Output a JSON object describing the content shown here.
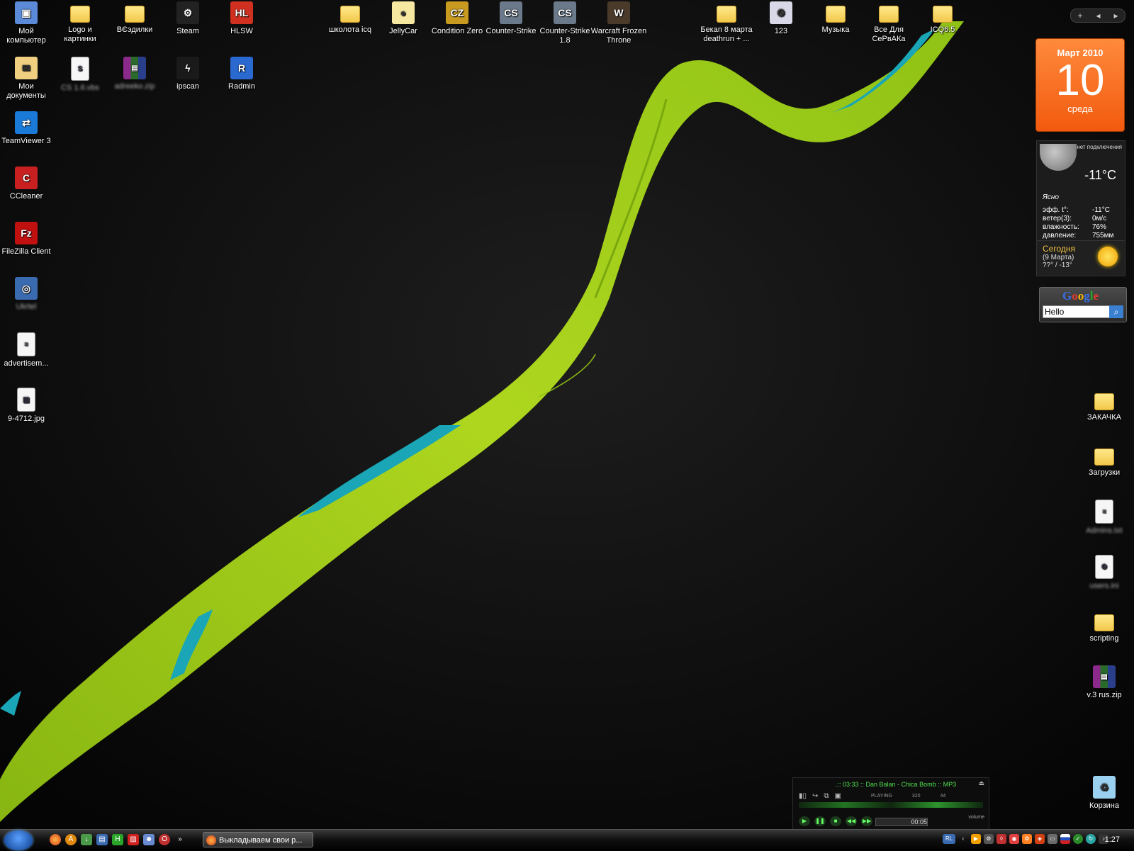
{
  "desktop": {
    "top_icons": [
      {
        "label": "Мой компьютер",
        "icon": "computer-icon"
      },
      {
        "label": "Logo и картинки",
        "icon": "folder-icon"
      },
      {
        "label": "ВЄэдилки",
        "icon": "folder-icon"
      },
      {
        "label": "Steam",
        "icon": "steam-icon"
      },
      {
        "label": "HLSW",
        "icon": "hlsw-icon"
      },
      {
        "label": "школота icq",
        "icon": "folder-icon"
      },
      {
        "label": "JellyCar",
        "icon": "jellycar-icon"
      },
      {
        "label": "Condition Zero",
        "icon": "condition-zero-icon"
      },
      {
        "label": "Counter-Strike",
        "icon": "counter-strike-icon"
      },
      {
        "label": "Counter-Strike 1.8",
        "icon": "counter-strike-icon"
      },
      {
        "label": "Warcraft Frozen Throne",
        "icon": "warcraft-icon"
      },
      {
        "label": "Бекап 8 марта deathrun + ...",
        "icon": "folder-icon"
      },
      {
        "label": "123",
        "icon": "program-icon"
      },
      {
        "label": "Музыка",
        "icon": "folder-icon"
      },
      {
        "label": "Все Для СеРвАКа",
        "icon": "folder-icon"
      },
      {
        "label": "ICQ6.5",
        "icon": "folder-icon"
      }
    ],
    "row2_icons": [
      {
        "label": "Мои документы",
        "icon": "my-documents-icon"
      },
      {
        "label": "CS 1.6.vbs",
        "icon": "script-icon",
        "blurred": true
      },
      {
        "label": "adreeko.zip",
        "icon": "archive-icon",
        "blurred": true
      },
      {
        "label": "ipscan",
        "icon": "ipscan-icon"
      },
      {
        "label": "Radmin",
        "icon": "radmin-icon"
      }
    ],
    "left_icons": [
      {
        "label": "TeamViewer 3",
        "icon": "teamviewer-icon"
      },
      {
        "label": "CCleaner",
        "icon": "ccleaner-icon"
      },
      {
        "label": "FileZilla Client",
        "icon": "filezilla-icon"
      },
      {
        "label": "Ukrtel",
        "icon": "network-icon",
        "blurred": true
      },
      {
        "label": "advertisem...",
        "icon": "text-document-icon"
      },
      {
        "label": "9-4712.jpg",
        "icon": "image-file-icon"
      }
    ],
    "right_icons": [
      {
        "label": "ЗАКАЧКА",
        "icon": "folder-icon"
      },
      {
        "label": "Загрузки",
        "icon": "folder-icon"
      },
      {
        "label": "Admins.txt",
        "icon": "text-document-icon",
        "blurred": true
      },
      {
        "label": "users.ini",
        "icon": "config-file-icon",
        "blurred": true
      },
      {
        "label": "scripting",
        "icon": "folder-icon"
      },
      {
        "label": "v.3 rus.zip",
        "icon": "archive-icon"
      },
      {
        "label": "Корзина",
        "icon": "recycle-bin-icon"
      }
    ]
  },
  "sidebar": {
    "add_label": "+",
    "prev_label": "◂",
    "next_label": "▸"
  },
  "calendar": {
    "month": "Март 2010",
    "day": "10",
    "weekday": "среда"
  },
  "weather": {
    "connection": "нет подключения",
    "temperature": "-11°C",
    "condition": "Ясно",
    "rows": [
      {
        "label": "эфф. t°:",
        "value": "-11°C"
      },
      {
        "label": "ветер(3):",
        "value": "0м/с"
      },
      {
        "label": "влажность:",
        "value": "76%"
      },
      {
        "label": "давление:",
        "value": "755мм"
      }
    ],
    "today_title": "Сегодня",
    "today_date": "(9 Марта)",
    "today_range": "??° / -13°"
  },
  "google": {
    "logo_letters": [
      "G",
      "o",
      "o",
      "g",
      "l",
      "e"
    ],
    "search_value": "Hello"
  },
  "player": {
    "title": ".:: 03:33 :: Dan Balan - Chica Bomb :: MP3",
    "status": "PLAYING",
    "bitrate": "320",
    "khz": "44",
    "time": "00:05",
    "volume_label": "volume"
  },
  "taskbar": {
    "task_title": "Выкладываем свои р...",
    "more_label": "»",
    "tray_lang": "RL",
    "clock": "1:27"
  },
  "colors": {
    "ribbon_green": "#a8d41c",
    "ribbon_teal": "#1aa6b7",
    "calendar_orange": "#f25a0e"
  }
}
